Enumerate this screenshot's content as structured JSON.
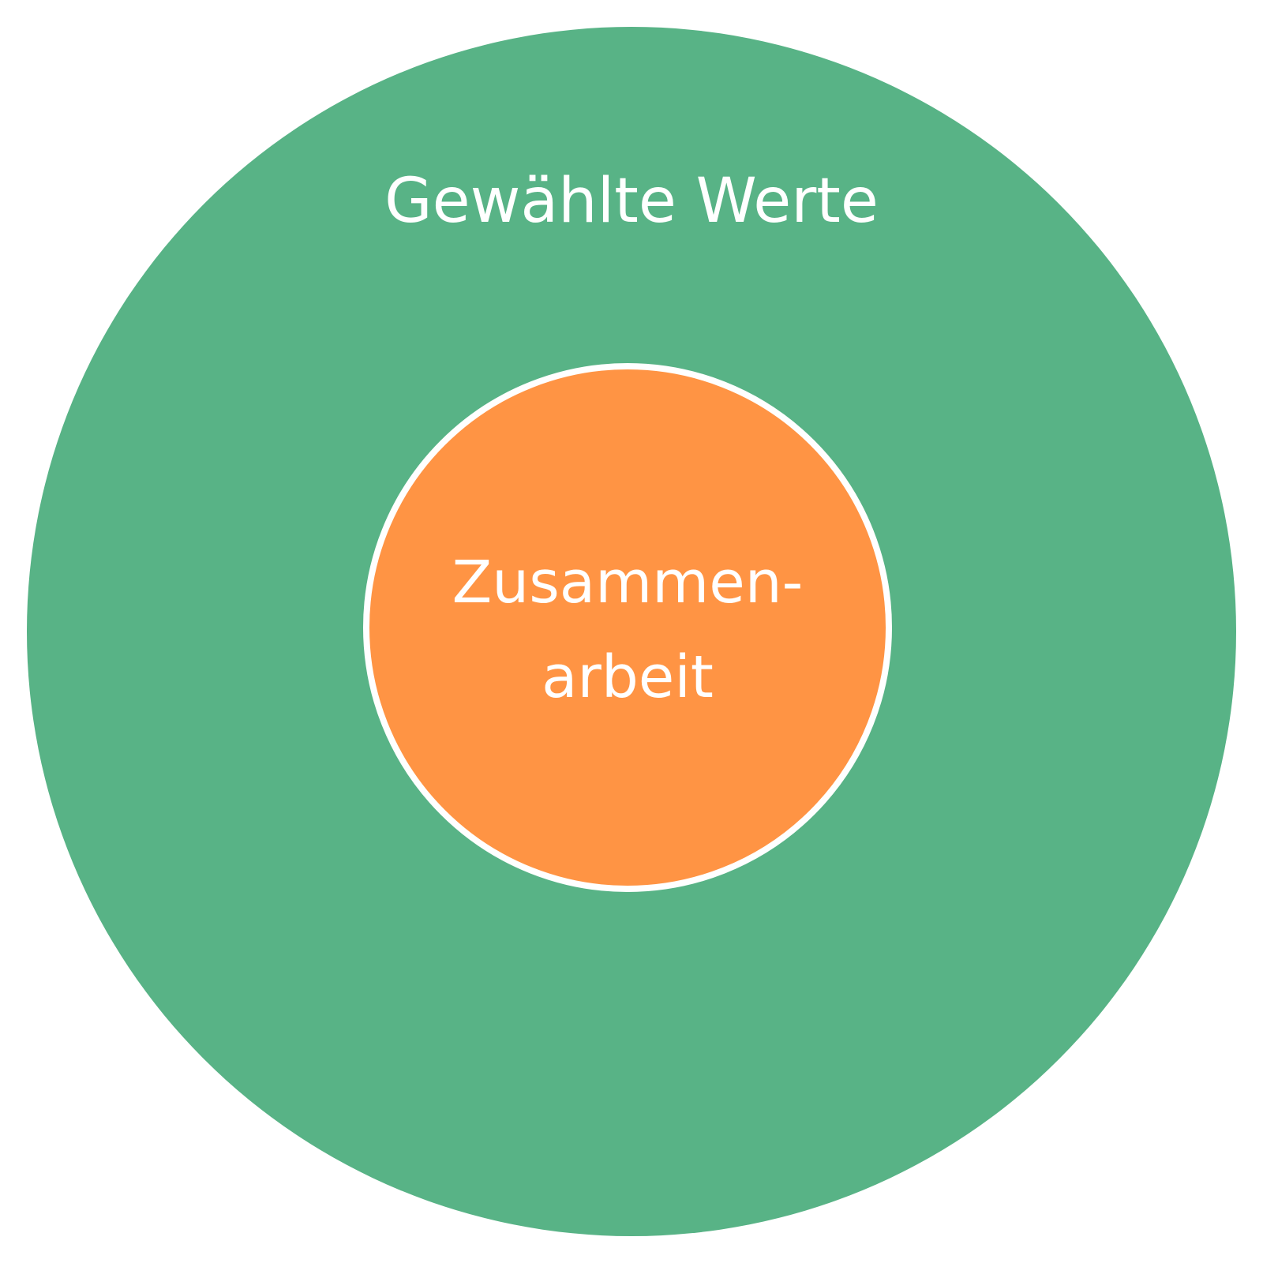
{
  "diagram": {
    "outer": {
      "label": "Gewählte Werte",
      "color": "#58b386"
    },
    "inner": {
      "label_lines": [
        "Zusammen-",
        "arbeit"
      ],
      "color": "#ff9444",
      "border_color": "#ffffff"
    }
  }
}
